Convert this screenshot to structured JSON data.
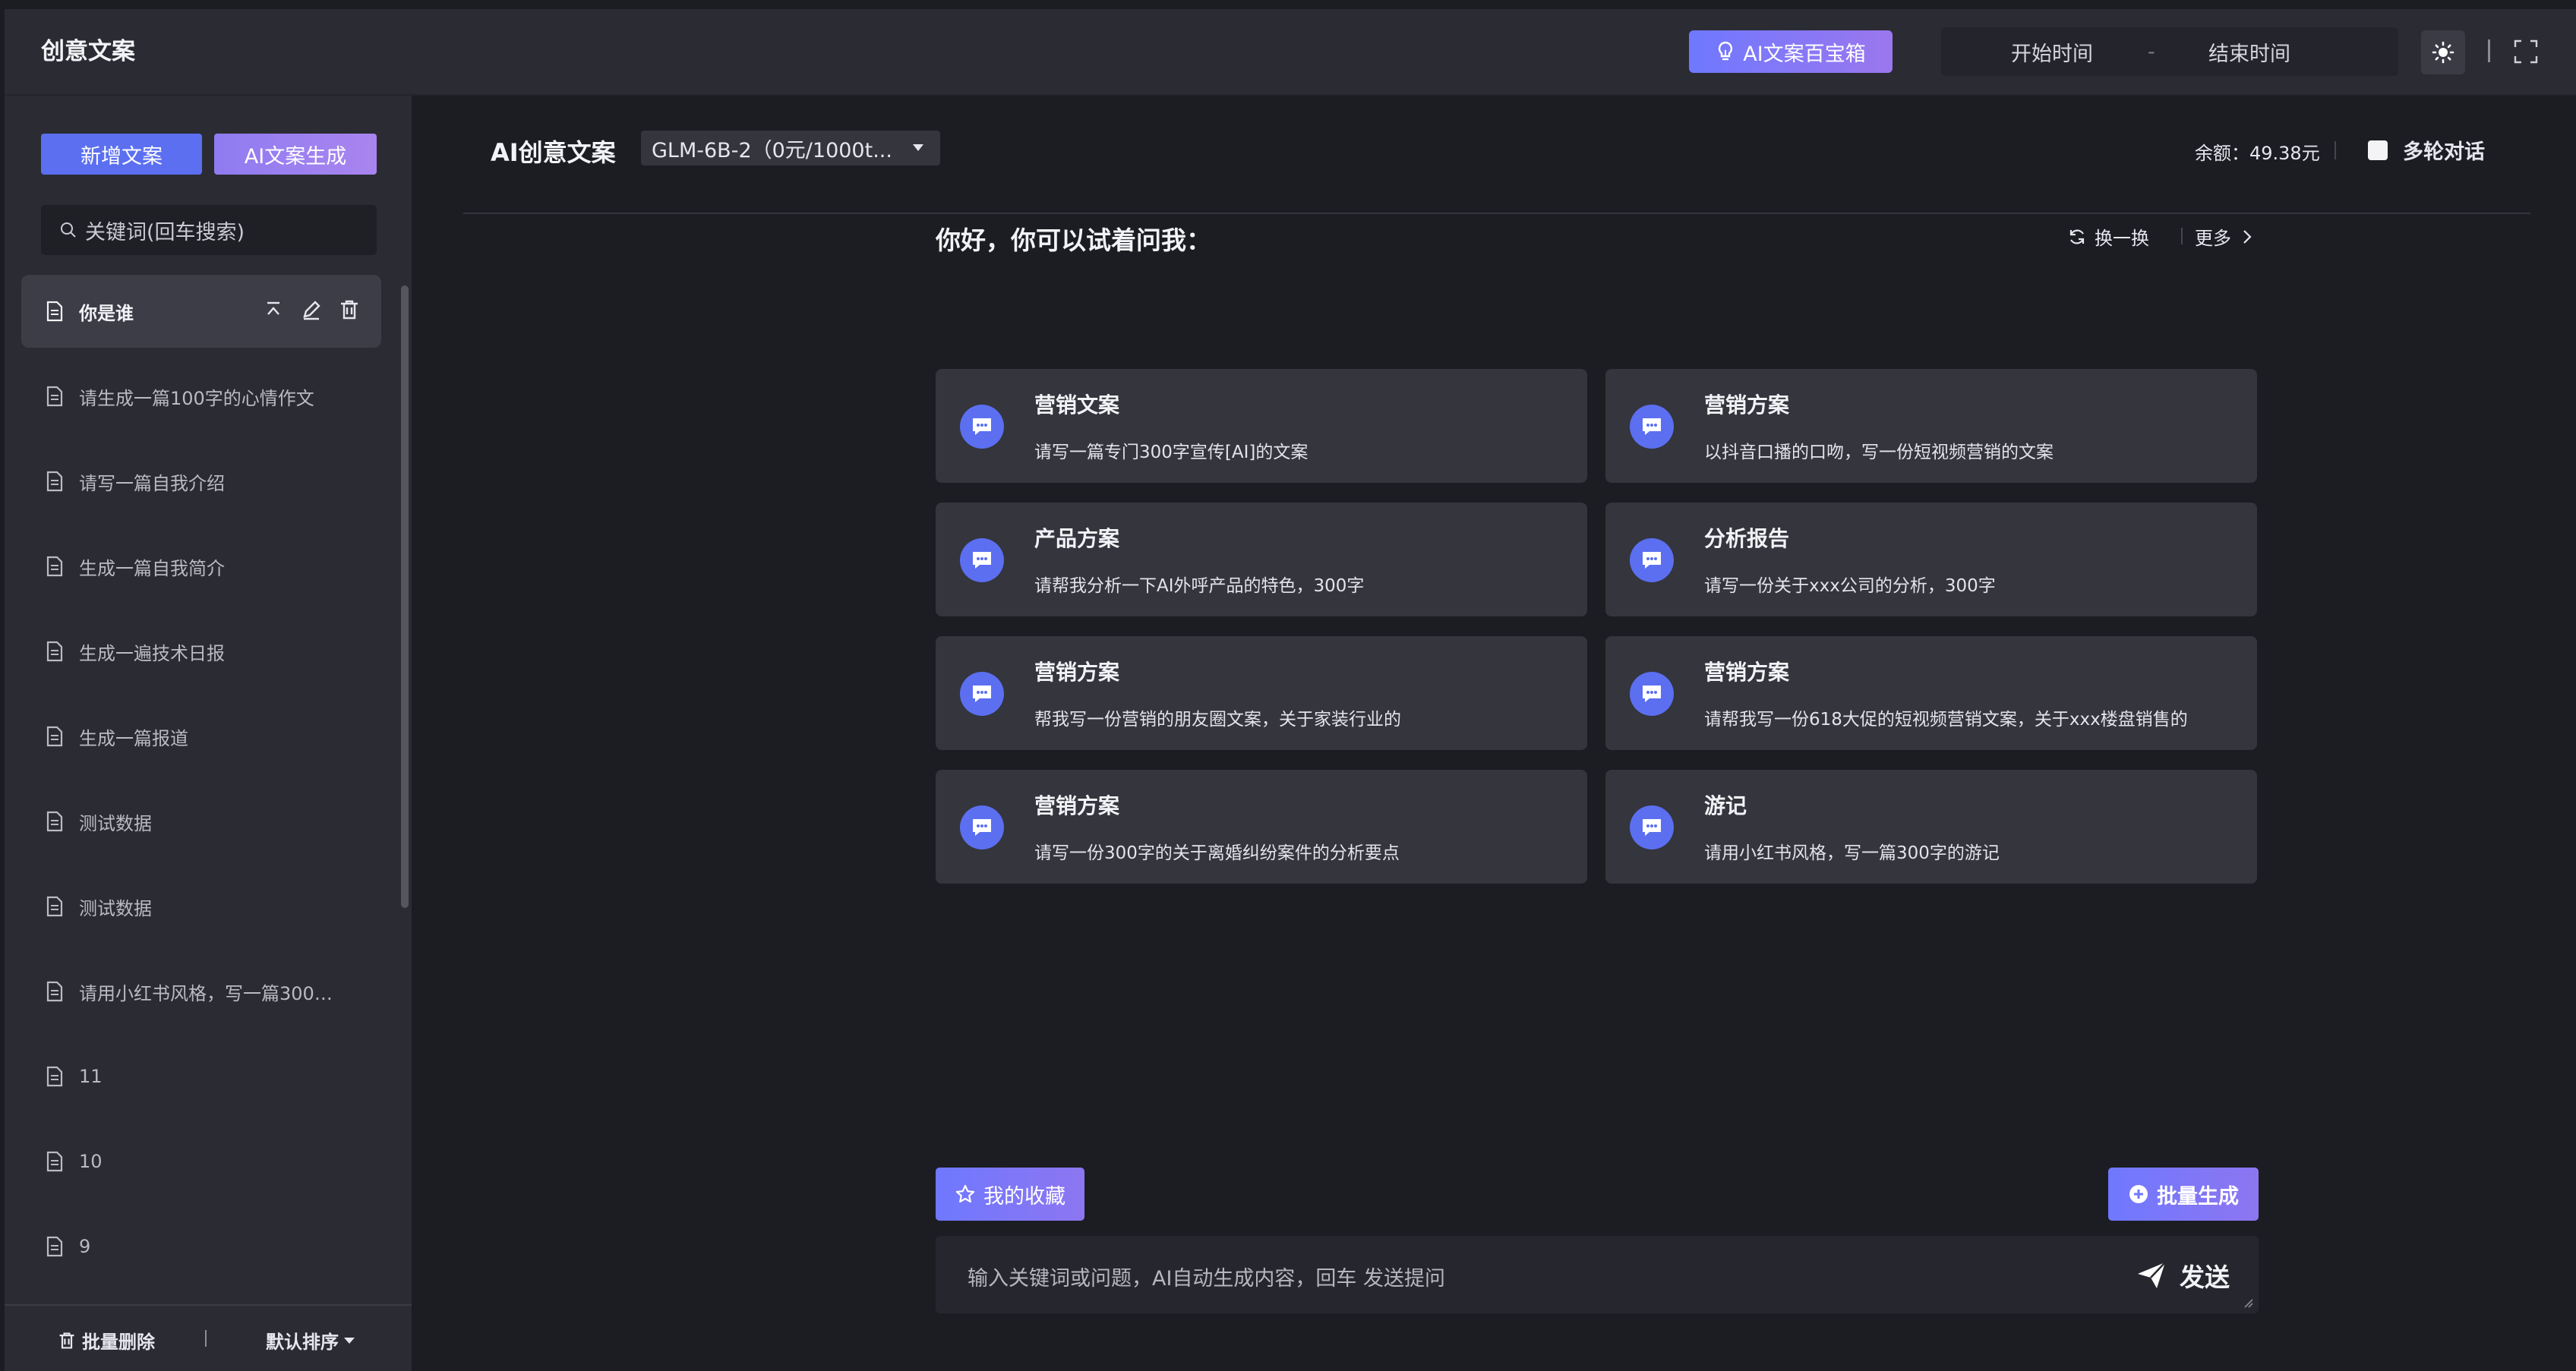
{
  "header": {
    "app_title": "创意文案",
    "toolbox_label": "AI文案百宝箱",
    "start_time_placeholder": "开始时间",
    "range_separator": "-",
    "end_time_placeholder": "结束时间",
    "icons": {
      "toolbox": "lightbulb-icon",
      "theme": "sun-icon",
      "fullscreen": "fullscreen-icon"
    }
  },
  "sidebar": {
    "new_button": "新增文案",
    "ai_button": "AI文案生成",
    "search_placeholder": "关键词(回车搜索)",
    "items": [
      {
        "label": "你是谁",
        "active": true
      },
      {
        "label": "请生成一篇100字的心情作文",
        "active": false
      },
      {
        "label": "请写一篇自我介绍",
        "active": false
      },
      {
        "label": "生成一篇自我简介",
        "active": false
      },
      {
        "label": "生成一遍技术日报",
        "active": false
      },
      {
        "label": "生成一篇报道",
        "active": false
      },
      {
        "label": "测试数据",
        "active": false
      },
      {
        "label": "测试数据",
        "active": false
      },
      {
        "label": "请用小红书风格，写一篇300字...",
        "active": false
      },
      {
        "label": "11",
        "active": false
      },
      {
        "label": "10",
        "active": false
      },
      {
        "label": "9",
        "active": false
      }
    ],
    "footer": {
      "batch_delete": "批量删除",
      "sort": "默认排序"
    }
  },
  "main": {
    "title": "AI创意文案",
    "model": "GLM-6B-2（0元/1000t...",
    "balance": "余额：49.38元",
    "multi_turn": "多轮对话",
    "greeting": "你好，你可以试着问我：",
    "refresh": "换一换",
    "more": "更多",
    "cards": [
      {
        "title": "营销文案",
        "desc": "请写一篇专门300字宣传[AI]的文案"
      },
      {
        "title": "营销方案",
        "desc": "以抖音口播的口吻，写一份短视频营销的文案"
      },
      {
        "title": "产品方案",
        "desc": "请帮我分析一下AI外呼产品的特色，300字"
      },
      {
        "title": "分析报告",
        "desc": "请写一份关于xxx公司的分析，300字"
      },
      {
        "title": "营销方案",
        "desc": "帮我写一份营销的朋友圈文案，关于家装行业的"
      },
      {
        "title": "营销方案",
        "desc": "请帮我写一份618大促的短视频营销文案，关于xxx楼盘销售的"
      },
      {
        "title": "营销方案",
        "desc": "请写一份300字的关于离婚纠纷案件的分析要点"
      },
      {
        "title": "游记",
        "desc": "请用小红书风格，写一篇300字的游记"
      }
    ],
    "favorites": "我的收藏",
    "batch_generate": "批量生成",
    "input_placeholder": "输入关键词或问题，AI自动生成内容，回车 发送提问",
    "send": "发送"
  },
  "colors": {
    "accent": "#5b6ff0",
    "gradient_end": "#9b77ee",
    "sidebar_bg": "#2b2c33",
    "main_bg": "#1c1d22",
    "card_bg": "#34353d"
  }
}
